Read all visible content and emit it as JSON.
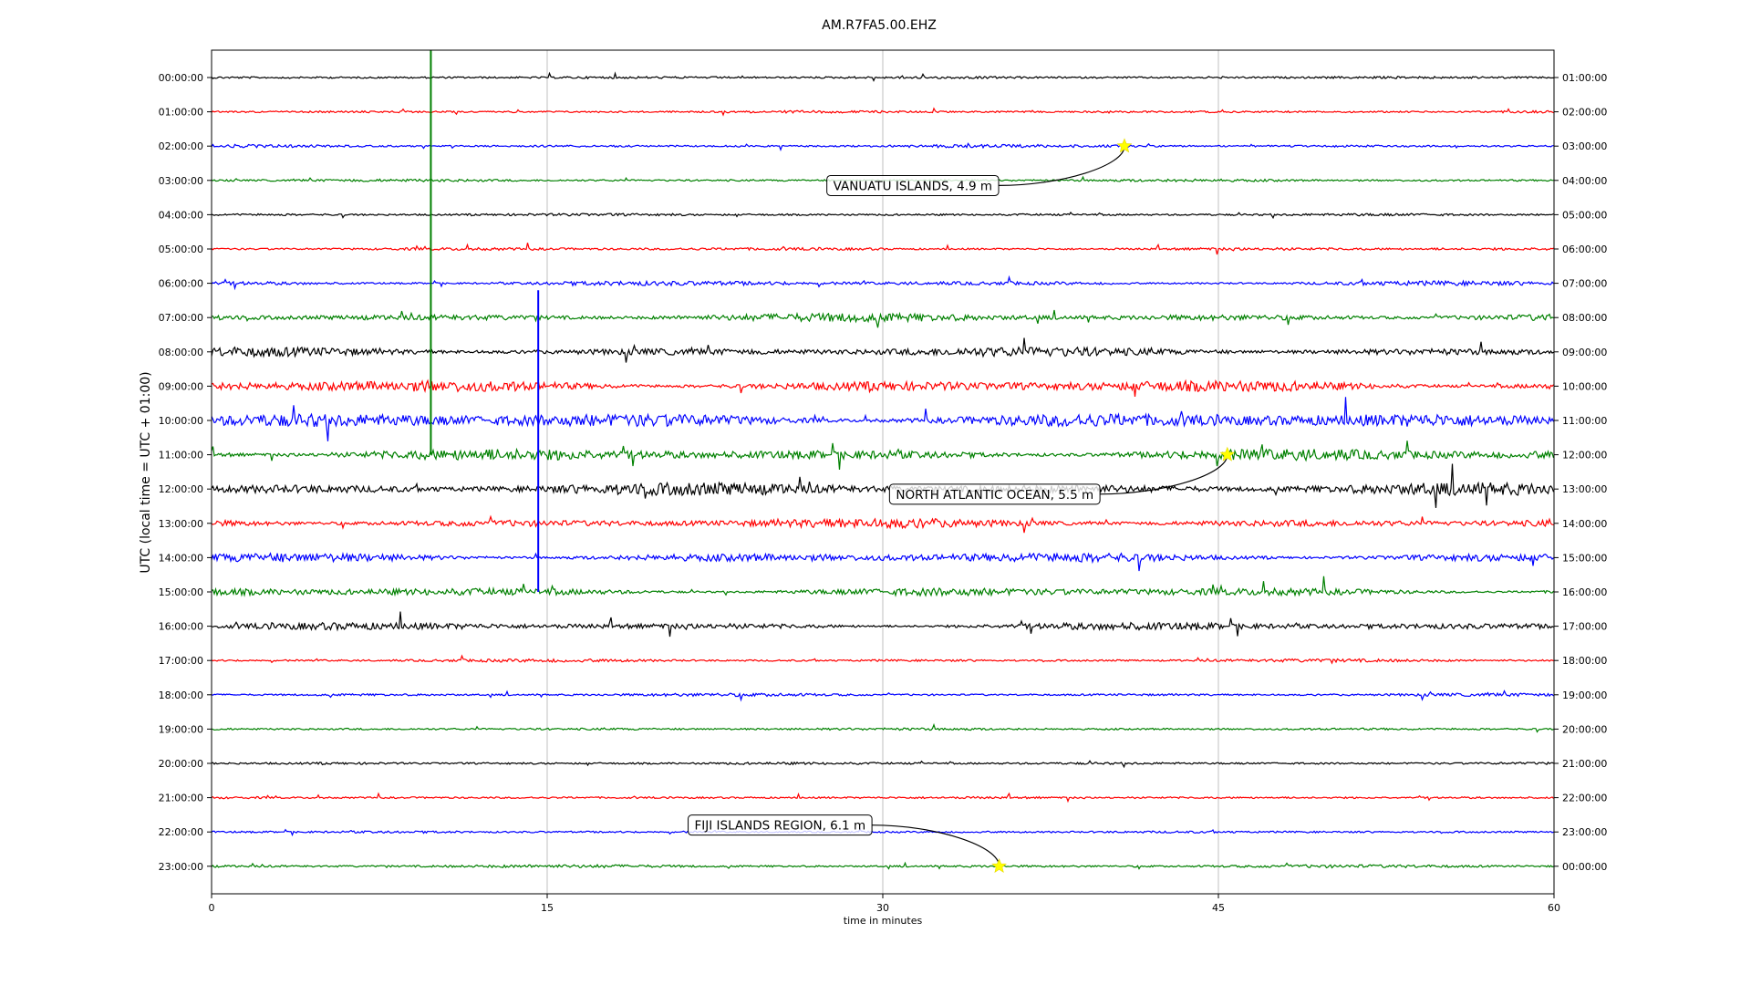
{
  "chart_data": {
    "type": "line",
    "title": "AM.R7FA5.00.EHZ",
    "xlabel": "time in minutes",
    "ylabel": "UTC (local time = UTC + 01:00)",
    "xlim": [
      0,
      60
    ],
    "x_ticks": [
      "0",
      "15",
      "30",
      "45",
      "60"
    ],
    "grid": "vertical",
    "colors": [
      "#000000",
      "#ff0000",
      "#0000ff",
      "#008000"
    ],
    "left_labels": [
      "00:00:00",
      "01:00:00",
      "02:00:00",
      "03:00:00",
      "04:00:00",
      "05:00:00",
      "06:00:00",
      "07:00:00",
      "08:00:00",
      "09:00:00",
      "10:00:00",
      "11:00:00",
      "12:00:00",
      "13:00:00",
      "14:00:00",
      "15:00:00",
      "16:00:00",
      "17:00:00",
      "18:00:00",
      "19:00:00",
      "20:00:00",
      "21:00:00",
      "22:00:00",
      "23:00:00"
    ],
    "right_labels": [
      "01:00:00",
      "02:00:00",
      "03:00:00",
      "04:00:00",
      "05:00:00",
      "06:00:00",
      "07:00:00",
      "08:00:00",
      "09:00:00",
      "10:00:00",
      "11:00:00",
      "12:00:00",
      "13:00:00",
      "14:00:00",
      "15:00:00",
      "16:00:00",
      "17:00:00",
      "18:00:00",
      "19:00:00",
      "20:00:00",
      "21:00:00",
      "22:00:00",
      "23:00:00",
      "00:00:00"
    ],
    "noise_level": [
      0.25,
      0.25,
      0.3,
      0.25,
      0.25,
      0.3,
      0.45,
      0.8,
      0.9,
      1.1,
      1.4,
      1.1,
      1.2,
      0.9,
      0.9,
      0.8,
      0.7,
      0.3,
      0.3,
      0.25,
      0.25,
      0.2,
      0.2,
      0.3
    ],
    "events": [
      {
        "label": "VANUATU ISLANDS, 4.9 m",
        "row": 2,
        "minute": 40.8,
        "label_row": 3.15,
        "label_minute": 27.5
      },
      {
        "label": "NORTH ATLANTIC OCEAN, 5.5 m",
        "row": 11,
        "minute": 45.4,
        "label_row": 12.15,
        "label_minute": 30.3
      },
      {
        "label": "FIJI ISLANDS REGION, 6.1 m",
        "row": 23,
        "minute": 35.2,
        "label_row": 21.8,
        "label_minute": 21.3
      }
    ],
    "spikes": [
      {
        "row": 0,
        "minute": 9.8,
        "rows_spanned": 11,
        "color": "#008000"
      },
      {
        "row": 7,
        "minute": 14.6,
        "rows_spanned": 8,
        "color": "#0000ff"
      }
    ]
  }
}
